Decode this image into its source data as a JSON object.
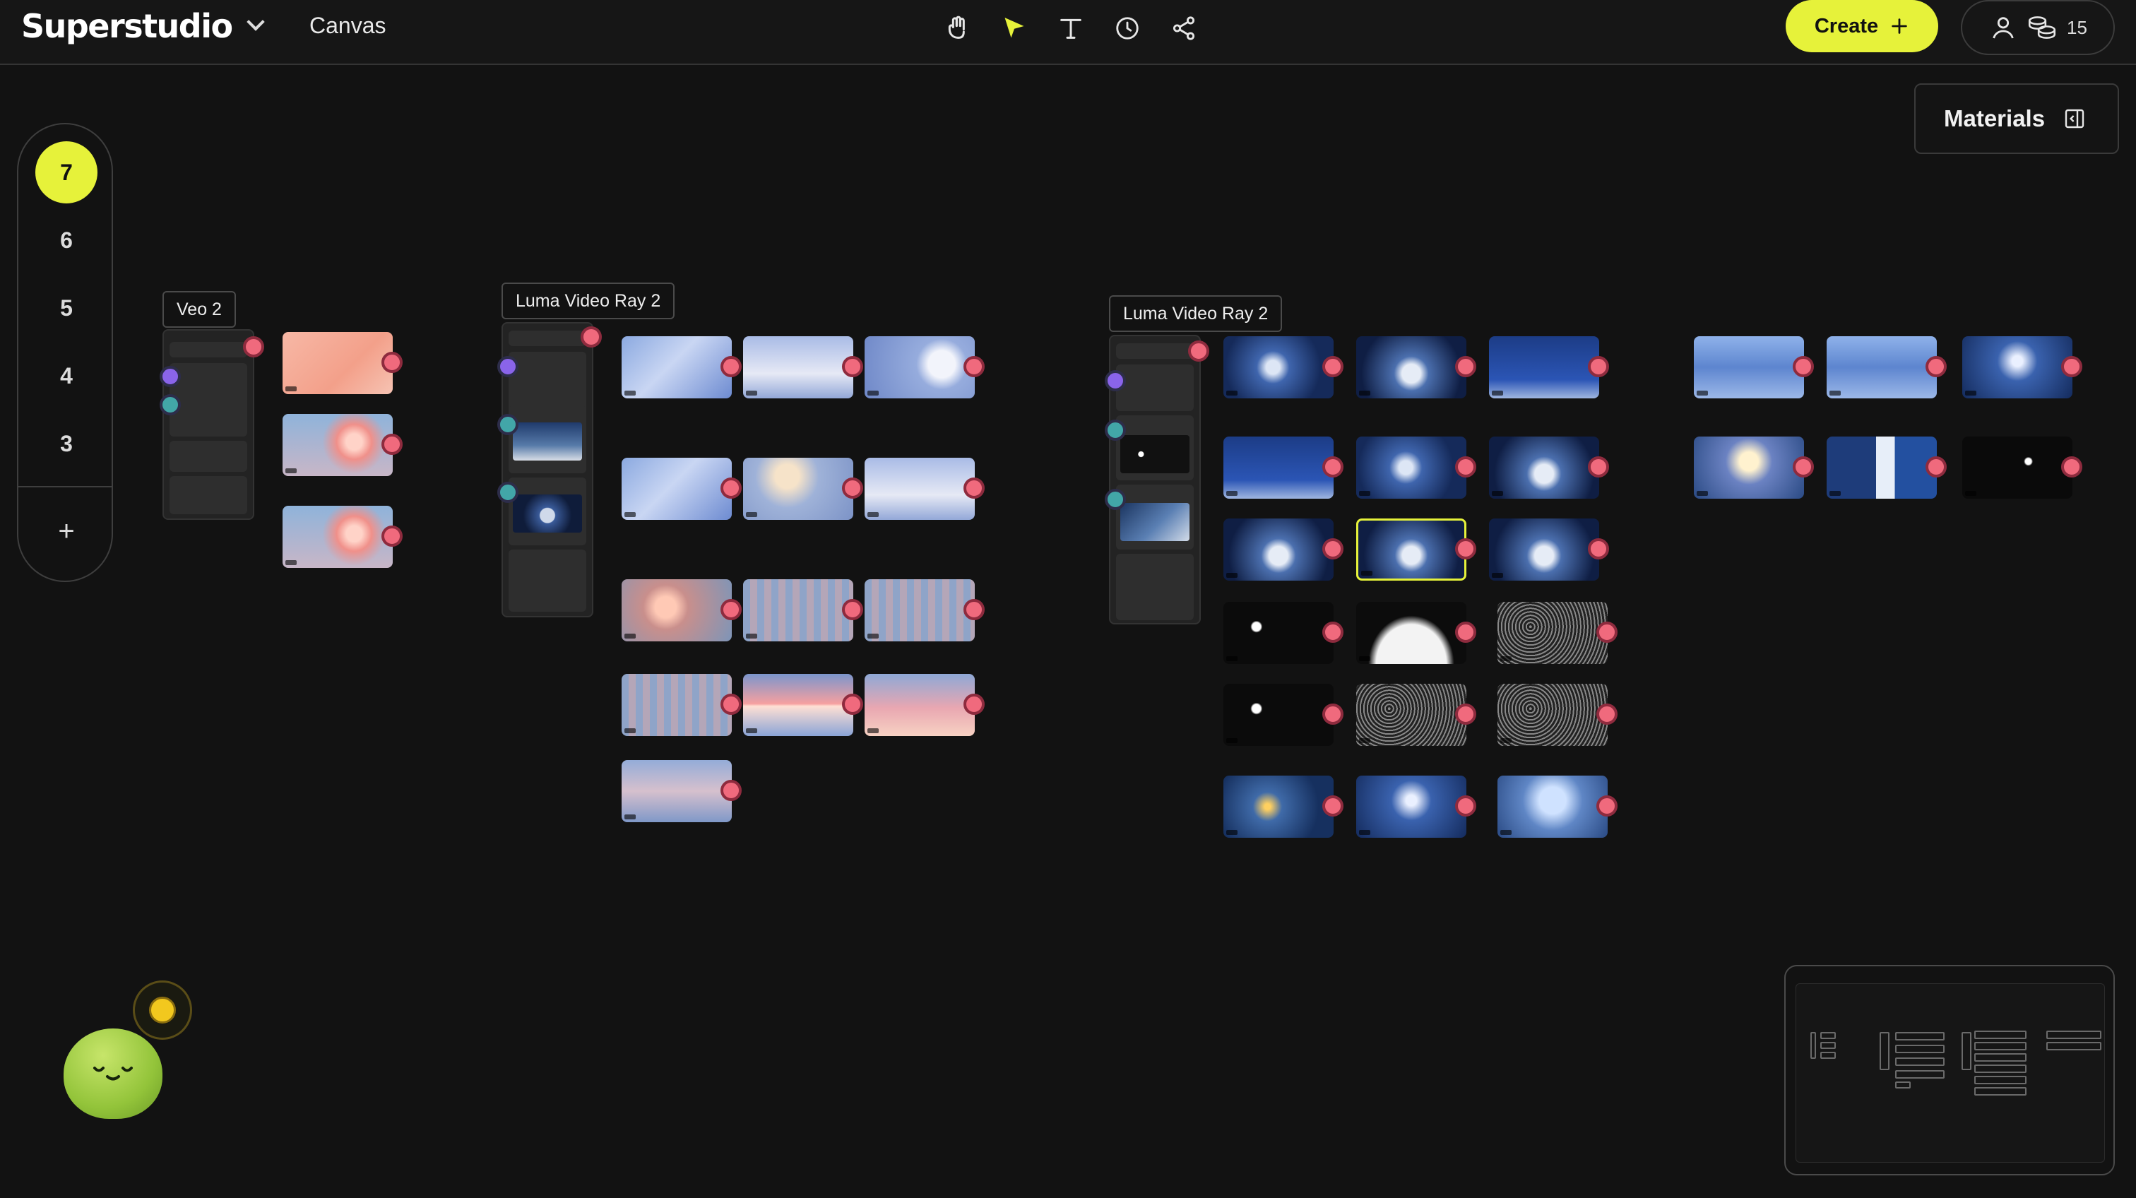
{
  "app": {
    "brand": "Superstudio",
    "page_title": "Canvas"
  },
  "toolbar": {
    "tools": [
      "hand-icon",
      "pointer-icon",
      "text-icon",
      "history-icon",
      "share-icon"
    ],
    "active_tool": "pointer-icon"
  },
  "header": {
    "create_label": "Create",
    "credits": "15"
  },
  "materials": {
    "label": "Materials"
  },
  "layers": {
    "items": [
      "7",
      "6",
      "5",
      "4",
      "3"
    ],
    "active": "7",
    "add_label": "+"
  },
  "groups": [
    {
      "label": "Veo 2"
    },
    {
      "label": "Luma Video Ray 2"
    },
    {
      "label": "Luma Video Ray 2"
    }
  ],
  "colors": {
    "accent": "#e6f23a",
    "output_port": "#f06a7d",
    "prompt_port": "#8a64ea",
    "image_port": "#42a6a8",
    "background": "#121212"
  }
}
